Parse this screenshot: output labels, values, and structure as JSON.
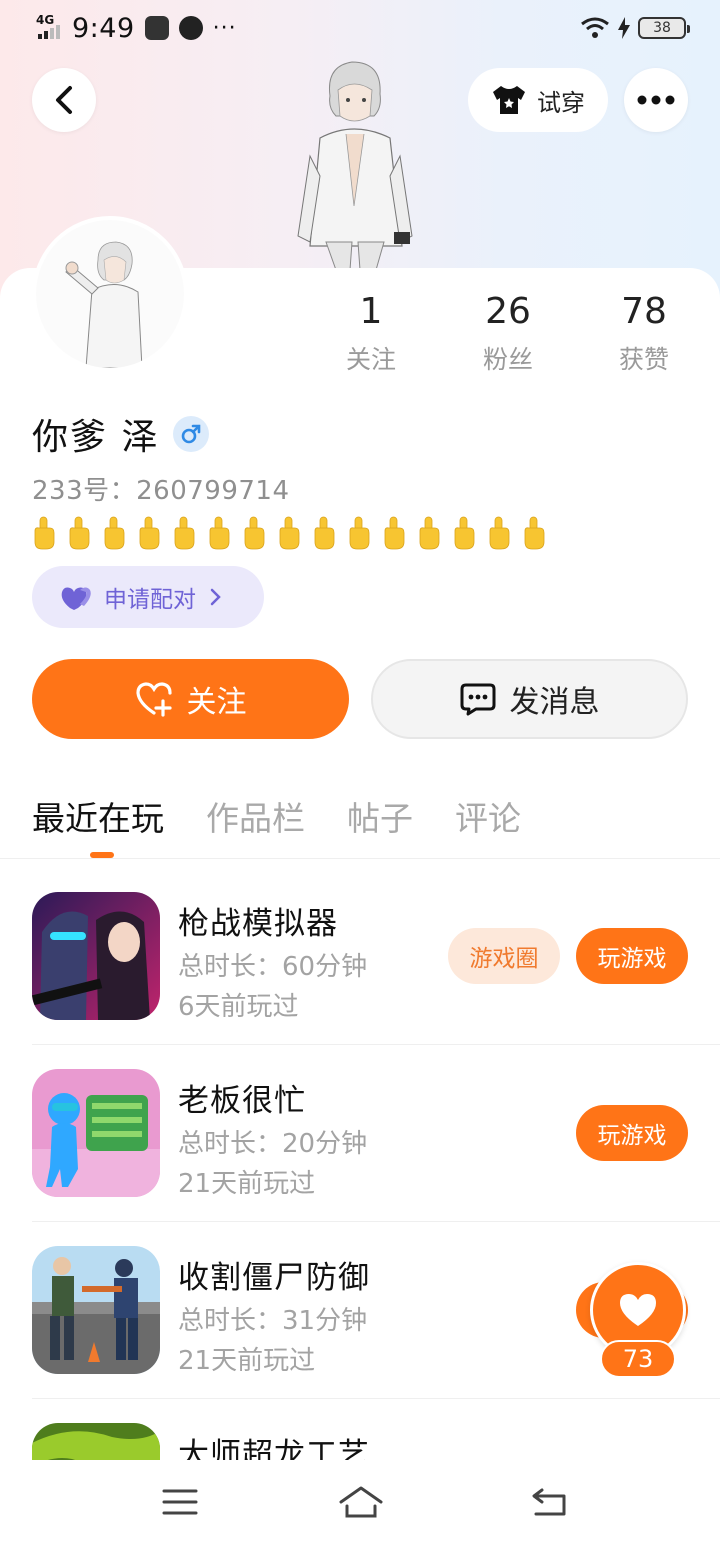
{
  "status_bar": {
    "network": "4G",
    "time": "9:49",
    "extra": "···",
    "battery": "38"
  },
  "header": {
    "try_on_label": "试穿"
  },
  "profile": {
    "following_count": "1",
    "following_label": "关注",
    "fans_count": "26",
    "fans_label": "粉丝",
    "likes_count": "78",
    "likes_label": "获赞",
    "name": "你爹 泽",
    "gender": "male",
    "uid_text": "233号：260799714",
    "signature_emoji_count": 15,
    "pair_label": "申请配对"
  },
  "actions": {
    "follow_label": "关注",
    "message_label": "发消息"
  },
  "tabs": [
    {
      "label": "最近在玩",
      "active": true
    },
    {
      "label": "作品栏",
      "active": false
    },
    {
      "label": "帖子",
      "active": false
    },
    {
      "label": "评论",
      "active": false
    }
  ],
  "games": [
    {
      "title": "枪战模拟器",
      "duration": "总时长：60分钟",
      "last_played": "6天前玩过",
      "circle_label": "游戏圈",
      "play_label": "玩游戏"
    },
    {
      "title": "老板很忙",
      "duration": "总时长：20分钟",
      "last_played": "21天前玩过",
      "play_label": "玩游戏"
    },
    {
      "title": "收割僵尸防御",
      "duration": "总时长：31分钟",
      "last_played": "21天前玩过"
    },
    {
      "title": "大师超龙工艺"
    }
  ],
  "floating_like": {
    "count": "73"
  },
  "colors": {
    "accent": "#ff7417",
    "pair_bg": "#ebe9fb",
    "pair_text": "#6f63d6",
    "muted_text": "#a3a3a3"
  }
}
